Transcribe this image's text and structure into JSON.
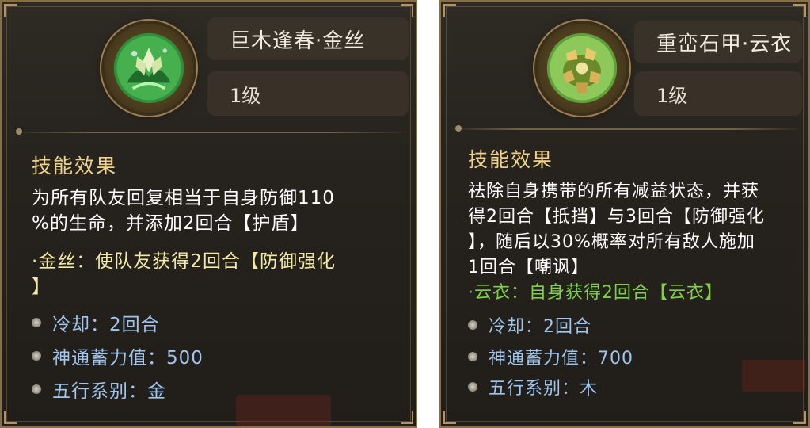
{
  "cards": [
    {
      "name": "巨木逢春·金丝",
      "level": "1级",
      "section_title": "技能效果",
      "description_lines": [
        "为所有队友回复相当于自身防御110",
        "%的生命，并添加2回合【护盾】"
      ],
      "special_lines": [
        "·金丝：使队友获得2回合【防御强化",
        "】"
      ],
      "special_color": "#f3e9a6",
      "stats": [
        {
          "label": "冷却：2回合"
        },
        {
          "label": "神通蓄力值：500"
        },
        {
          "label": "五行系别：金"
        }
      ],
      "icon": "golden-lotus-skill-icon",
      "icon_color": "#4caf50"
    },
    {
      "name": "重峦石甲·云衣",
      "level": "1级",
      "section_title": "技能效果",
      "description_lines": [
        "祛除自身携带的所有减益状态，并获",
        "得2回合【抵挡】与3回合【防御强化",
        "】，随后以30%概率对所有敌人施加",
        "1回合【嘲讽】"
      ],
      "special_lines": [
        "·云衣：自身获得2回合【云衣】"
      ],
      "special_color": "#7fd14a",
      "stats": [
        {
          "label": "冷却：2回合"
        },
        {
          "label": "神通蓄力值：700"
        },
        {
          "label": "五行系别：木"
        }
      ],
      "icon": "stone-armor-skill-icon",
      "icon_color": "#c9a24a"
    }
  ],
  "colors": {
    "title_gold": "#f0d28a",
    "stat_blue": "#9fc6ee",
    "frame_bronze": "#8a6f45"
  }
}
